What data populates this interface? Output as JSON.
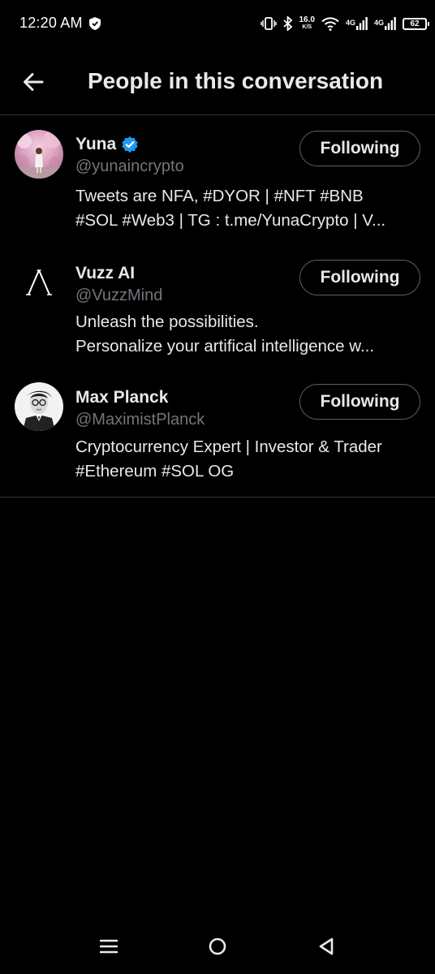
{
  "status_bar": {
    "time": "12:20 AM",
    "net_speed_value": "16.0",
    "net_speed_unit": "K/S",
    "sim1_label": "4G",
    "sim2_label": "4G",
    "battery": "62"
  },
  "header": {
    "title": "People in this conversation"
  },
  "people": [
    {
      "name": "Yuna",
      "verified": true,
      "handle": "@yunaincrypto",
      "bio_lines": [
        "Tweets are NFA, #DYOR | #NFT #BNB",
        "#SOL #Web3 | TG : t.me/YunaCrypto | V..."
      ],
      "follow_label": "Following"
    },
    {
      "name": "Vuzz AI",
      "verified": false,
      "handle": "@VuzzMind",
      "bio_lines": [
        "Unleash the possibilities.",
        "Personalize your artifical intelligence w..."
      ],
      "follow_label": "Following"
    },
    {
      "name": "Max Planck",
      "verified": false,
      "handle": "@MaximistPlanck",
      "bio_lines": [
        "Cryptocurrency Expert | Investor & Trader",
        "#Ethereum #SOL OG"
      ],
      "follow_label": "Following"
    }
  ],
  "colors": {
    "background": "#000000",
    "primary_text": "#e7e9ea",
    "secondary_text": "#71767b",
    "verified_badge": "#1d9bf0",
    "divider": "#2f3336",
    "button_border": "#536471"
  },
  "icons": {
    "back": "arrow-left-icon",
    "verified": "verified-badge-icon",
    "nav_recents": "menu-icon",
    "nav_home": "circle-home-icon",
    "nav_back": "triangle-back-icon"
  }
}
